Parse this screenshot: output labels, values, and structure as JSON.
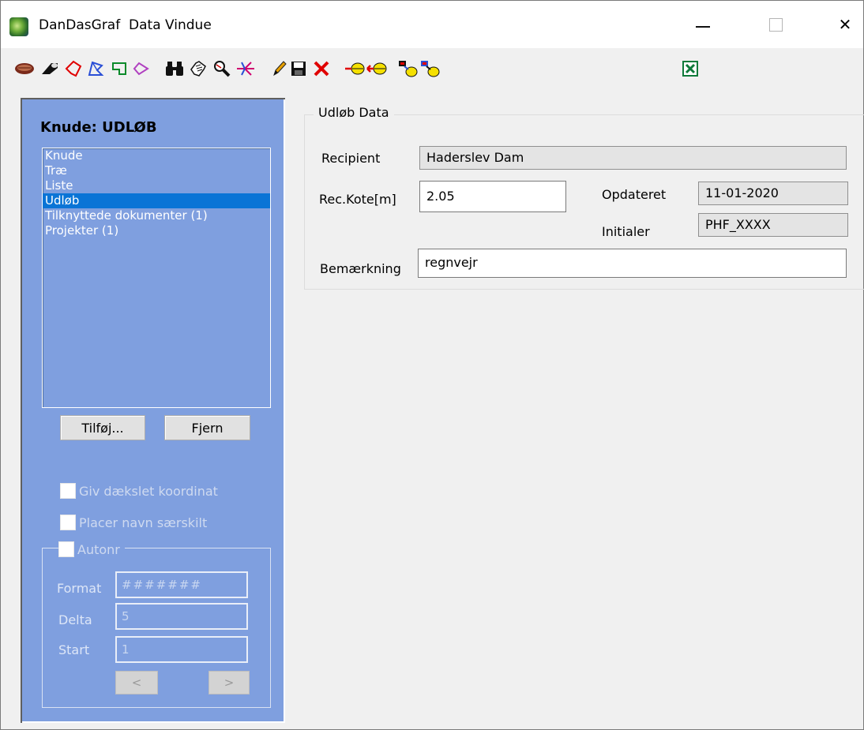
{
  "window": {
    "title": "DanDasGraf  Data Vindue",
    "minimize": "—",
    "close": "✕"
  },
  "toolbar": {
    "icons": [
      "manhole-icon",
      "pipe-icon",
      "polygon-red-icon",
      "polygon-blue-icon",
      "rectangle-green-icon",
      "diamond-purple-icon",
      "binoculars-icon",
      "hand-select-icon",
      "magnifier-icon",
      "network-branch-icon",
      "pencil-icon",
      "save-icon",
      "delete-icon",
      "insert-before-icon",
      "insert-after-icon",
      "copy-node-icon",
      "paste-node-icon",
      "excel-icon"
    ]
  },
  "left": {
    "title": "Knude: UDLØB",
    "list": [
      "Knude",
      "Træ",
      "Liste",
      "Udløb",
      "Tilknyttede dokumenter (1)",
      "Projekter (1)"
    ],
    "selected_index": 3,
    "add_button": "Tilføj...",
    "remove_button": "Fjern",
    "checkbox_cover": "Giv dækslet koordinat",
    "checkbox_name": "Placer navn særskilt",
    "checkbox_autonr": "Autonr",
    "format_label": "Format",
    "format_value": "#######",
    "delta_label": "Delta",
    "delta_value": "5",
    "start_label": "Start",
    "start_value": "1",
    "prev": "<",
    "next": ">"
  },
  "udlob": {
    "group_title": "Udløb Data",
    "recipient_label": "Recipient",
    "recipient_value": "Haderslev Dam",
    "rec_kote_label": "Rec.Kote[m]",
    "rec_kote_value": "2.05",
    "opdateret_label": "Opdateret",
    "opdateret_value": "11-01-2020",
    "initialer_label": "Initialer",
    "initialer_value": "PHF_XXXX",
    "bemaerkning_label": "Bemærkning",
    "bemaerkning_value": "regnvejr"
  }
}
